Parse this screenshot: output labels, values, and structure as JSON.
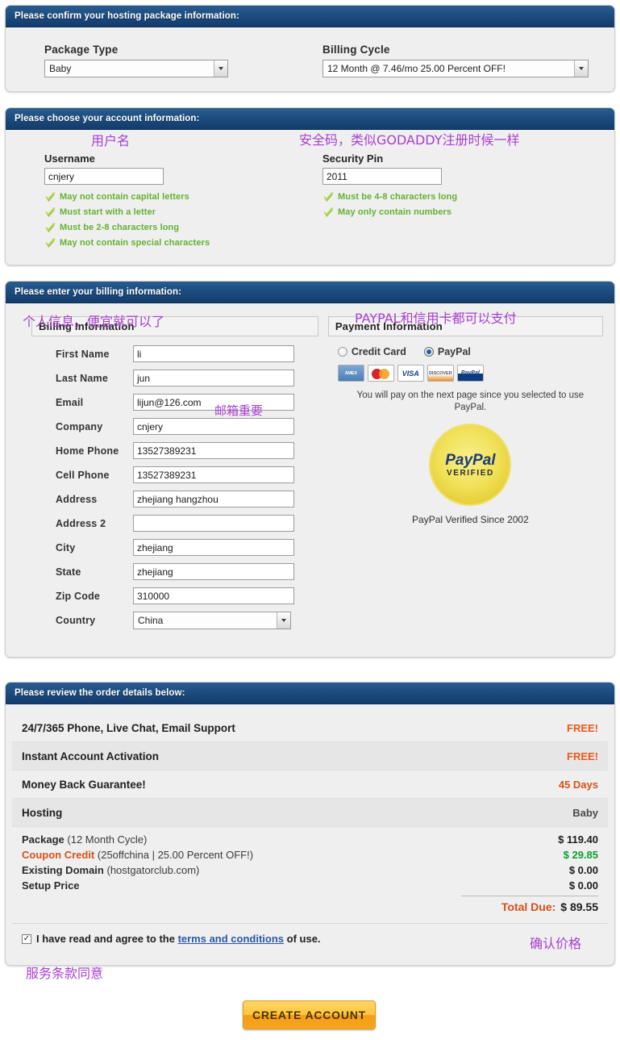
{
  "package_section": {
    "header": "Please confirm your hosting package information:",
    "package_type_label": "Package Type",
    "package_type_value": "Baby",
    "billing_cycle_label": "Billing Cycle",
    "billing_cycle_value": "12 Month @ 7.46/mo 25.00 Percent OFF!"
  },
  "account_section": {
    "header": "Please choose your account information:",
    "username_label": "Username",
    "username_value": "cnjery",
    "username_rules": [
      "May not contain capital letters",
      "Must start with a letter",
      "Must be 2-8 characters long",
      "May not contain special characters"
    ],
    "pin_label": "Security Pin",
    "pin_value": "2011",
    "pin_rules": [
      "Must be 4-8 characters long",
      "May only contain numbers"
    ]
  },
  "billing_section": {
    "header": "Please enter your billing information:",
    "billing_legend": "Billing Information",
    "payment_legend": "Payment Information",
    "fields": [
      {
        "label": "First Name",
        "value": "li",
        "type": "text"
      },
      {
        "label": "Last Name",
        "value": "jun",
        "type": "text"
      },
      {
        "label": "Email",
        "value": "lijun@126.com",
        "type": "text"
      },
      {
        "label": "Company",
        "value": "cnjery",
        "type": "text"
      },
      {
        "label": "Home Phone",
        "value": "13527389231",
        "type": "text"
      },
      {
        "label": "Cell Phone",
        "value": "13527389231",
        "type": "text"
      },
      {
        "label": "Address",
        "value": "zhejiang hangzhou",
        "type": "text"
      },
      {
        "label": "Address 2",
        "value": "",
        "type": "text"
      },
      {
        "label": "City",
        "value": "zhejiang",
        "type": "text"
      },
      {
        "label": "State",
        "value": "zhejiang",
        "type": "text"
      },
      {
        "label": "Zip Code",
        "value": "310000",
        "type": "text"
      },
      {
        "label": "Country",
        "value": "China",
        "type": "select"
      }
    ],
    "payment": {
      "credit_card_label": "Credit Card",
      "paypal_label": "PayPal",
      "selected": "PayPal",
      "card_logos": [
        "american-express",
        "mastercard",
        "visa",
        "discover",
        "paypal"
      ],
      "note": "You will pay on the next page since you selected to use PayPal.",
      "seal_title": "PayPal",
      "seal_sub": "VERIFIED",
      "seal_caption": "PayPal Verified Since 2002"
    }
  },
  "order_section": {
    "header": "Please review the order details below:",
    "rows": [
      {
        "label": "24/7/365 Phone, Live Chat, Email Support",
        "value": "FREE!",
        "style": "free"
      },
      {
        "label": "Instant Account Activation",
        "value": "FREE!",
        "style": "free"
      },
      {
        "label": "Money Back Guarantee!",
        "value": "45 Days",
        "style": "days"
      },
      {
        "label": "Hosting",
        "value": "Baby",
        "style": "plain"
      }
    ],
    "prices": [
      {
        "name": "Package",
        "note": "(12 Month Cycle)",
        "value": "$ 119.40",
        "highlight": false
      },
      {
        "name": "Coupon Credit",
        "note": "(25offchina | 25.00 Percent OFF!)",
        "value": "$ 29.85",
        "highlight": true
      },
      {
        "name": "Existing Domain",
        "note": "(hostgatorclub.com)",
        "value": "$ 0.00",
        "highlight": false
      },
      {
        "name": "Setup Price",
        "note": "",
        "value": "$ 0.00",
        "highlight": false
      }
    ],
    "total_label": "Total Due:",
    "total_value": "$ 89.55",
    "terms_checked": true,
    "terms_pre": "I have read and agree to the ",
    "terms_link": "terms and conditions",
    "terms_post": " of use."
  },
  "submit": {
    "create_account_label": "CREATE ACCOUNT"
  },
  "annotations": {
    "username": "用户名",
    "pin": "安全码，类似GODADDY注册时候一样",
    "personal": "个人信息，便宜就可以了",
    "payment": "PAYPAL和信用卡都可以支付",
    "email": "邮箱重要",
    "price": "确认价格",
    "terms": "服务条款同意"
  },
  "colors": {
    "header_blue": "#1d4d80",
    "annotation_purple": "#a93fd0",
    "free_orange": "#e8591b",
    "coupon_green": "#0f9d2f",
    "link_blue": "#2b57a8",
    "rule_green": "#66b032",
    "button_gold": "#ffc63f"
  }
}
